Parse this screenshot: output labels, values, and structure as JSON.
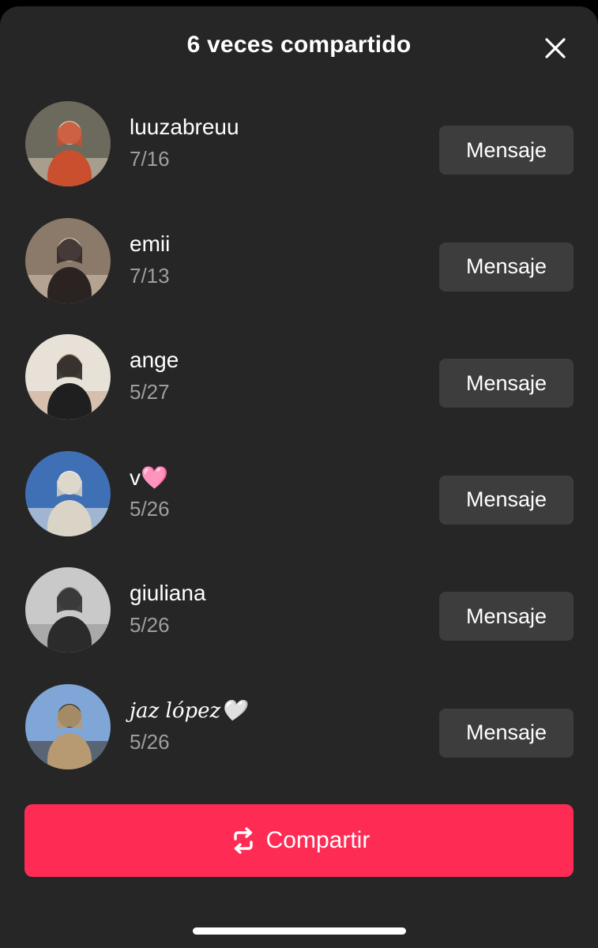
{
  "header": {
    "title": "6 veces compartido"
  },
  "icons": {
    "close": "close-icon",
    "repost": "repost-icon"
  },
  "users": [
    {
      "name": "luuzabreuu",
      "date": "7/16",
      "button": "Mensaje",
      "palette": [
        "#6b6a5c",
        "#c94f2e",
        "#d9c9b8"
      ]
    },
    {
      "name": "emii",
      "date": "7/13",
      "button": "Mensaje",
      "palette": [
        "#8b7a6a",
        "#2a2322",
        "#d8c4b2"
      ]
    },
    {
      "name": "ange",
      "date": "5/27",
      "button": "Mensaje",
      "palette": [
        "#e7e1d8",
        "#1f1f1f",
        "#c9a489"
      ]
    },
    {
      "name": "v🩷",
      "date": "5/26",
      "button": "Mensaje",
      "palette": [
        "#3f6fb5",
        "#d9d4c6",
        "#f1efe9"
      ]
    },
    {
      "name": "giuliana",
      "date": "5/26",
      "button": "Mensaje",
      "palette": [
        "#c9c9c9",
        "#2b2b2b",
        "#8e8e8e"
      ]
    },
    {
      "name": "𝑗𝑎𝑧 𝑙𝑜́𝑝𝑒𝑧🤍",
      "date": "5/26",
      "button": "Mensaje",
      "palette": [
        "#7fa6d6",
        "#b89a72",
        "#3b2f27"
      ]
    }
  ],
  "share": {
    "label": "Compartir"
  },
  "colors": {
    "sheet_bg": "#262626",
    "button_bg": "#3d3d3d",
    "accent": "#fe2c55",
    "secondary_text": "#9e9e9e"
  }
}
